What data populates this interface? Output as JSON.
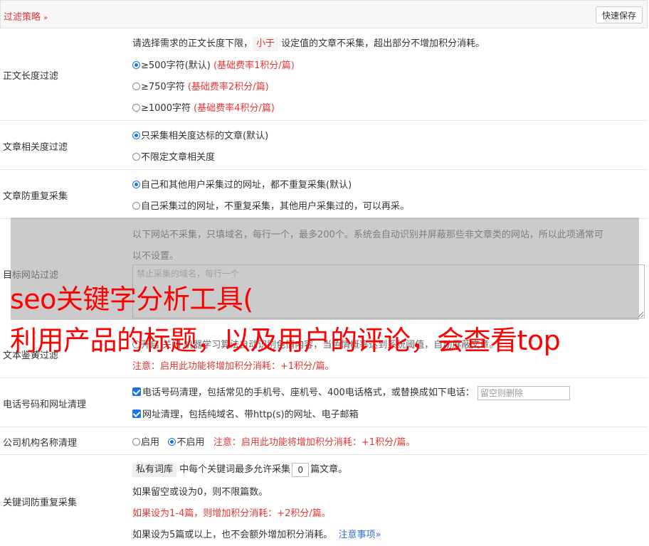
{
  "header": {
    "title": "过滤策略",
    "chevron": "»",
    "save_label": "快速保存"
  },
  "length_filter": {
    "label": "正文长度过滤",
    "desc_pre": "请选择需求的正文长度下限，",
    "desc_pill": "小于",
    "desc_post": "设定值的文章不采集，超出部分不增加积分消耗。",
    "options": [
      {
        "label": "≥500字符(默认)",
        "note": "(基础费率1积分/篇)",
        "selected": true
      },
      {
        "label": "≥750字符",
        "note": "(基础费率2积分/篇)",
        "selected": false
      },
      {
        "label": "≥1000字符",
        "note": "(基础费率4积分/篇)",
        "selected": false
      }
    ]
  },
  "relevance_filter": {
    "label": "文章相关度过滤",
    "options": [
      {
        "label": "只采集相关度达标的文章(默认)",
        "selected": true
      },
      {
        "label": "不限定文章相关度",
        "selected": false
      }
    ]
  },
  "dup_filter": {
    "label": "文章防重复采集",
    "options": [
      {
        "label": "自己和其他用户采集过的网址，都不重复采集(默认)",
        "selected": true
      },
      {
        "label": "自己采集过的网址，不重复采集，其他用户采集过的，可以再采。",
        "selected": false
      }
    ]
  },
  "site_filter": {
    "label": "目标网站过滤",
    "desc_line1": "以下网站不采集，只填域名，每行一个，最多200个。系统会自动识别并屏蔽那些非文章类的网站，所以此项通常可",
    "desc_line2": "以不设置。",
    "placeholder": "禁止采集的域名，每行一个"
  },
  "porn_filter": {
    "label": "文本鉴黄过滤",
    "line": "开启  关闭  机器学习算法自动识别色情内容，当色情概率达到系统阈值，自动屏蔽文章。",
    "note": "注意：启用此功能将增加积分消耗：+1积分/篇。"
  },
  "contact_clean": {
    "label": "电话号码和网址清理",
    "phone_label": "电话号码清理，包括常见的手机号、座机号、400电话格式，或替换成如下电话：",
    "phone_placeholder": "留空则删除",
    "url_label": "网址清理，包括纯域名、带http(s)的网址、电子邮箱"
  },
  "org_clean": {
    "label": "公司机构名称清理",
    "enable": "启用",
    "disable": "不启用",
    "note": "注意：启用此功能将增加积分消耗：+1积分/篇。"
  },
  "keyword_dup": {
    "label": "关键词防重复采集",
    "pill": "私有词库",
    "line1_mid": "中每个关键词最多允许采集",
    "count_value": "0",
    "line1_post": "篇文章。",
    "line2": "如果留空或设为0，则不限篇数。",
    "line3": "如果设为1-4篇，则增加积分消耗：+2积分/篇。",
    "line4": "如果设为5篇或以上，也不会额外增加积分消耗。",
    "notes_link": "注意事项"
  },
  "overlay_text": {
    "line1": "seo关键字分析工具(",
    "line2": "利用产品的标题，以及用户的评论，会查看top"
  },
  "colors": {
    "accent": "#e23636",
    "link": "#2f6fd1",
    "control": "#1a73e8"
  }
}
